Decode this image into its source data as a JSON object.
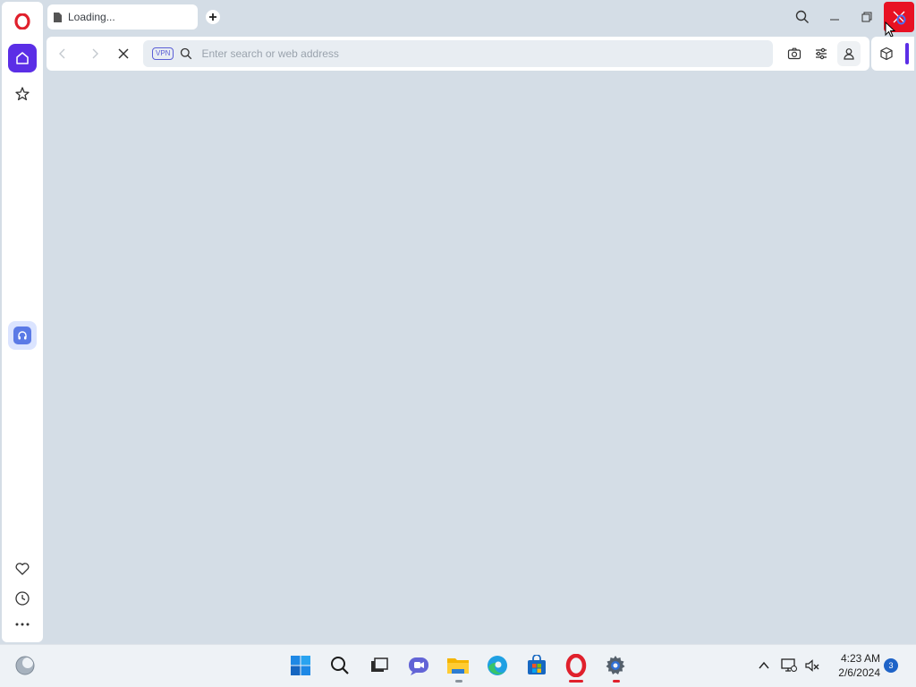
{
  "browser": {
    "tab_title": "Loading...",
    "address_placeholder": "Enter search or web address",
    "vpn_label": "VPN"
  },
  "taskbar": {
    "time": "4:23 AM",
    "date": "2/6/2024",
    "notification_count": "3"
  },
  "colors": {
    "opera_red": "#e0202c",
    "accent_purple": "#5b2ee6",
    "page_bg": "#d4dde6",
    "close_red": "#e81123"
  }
}
